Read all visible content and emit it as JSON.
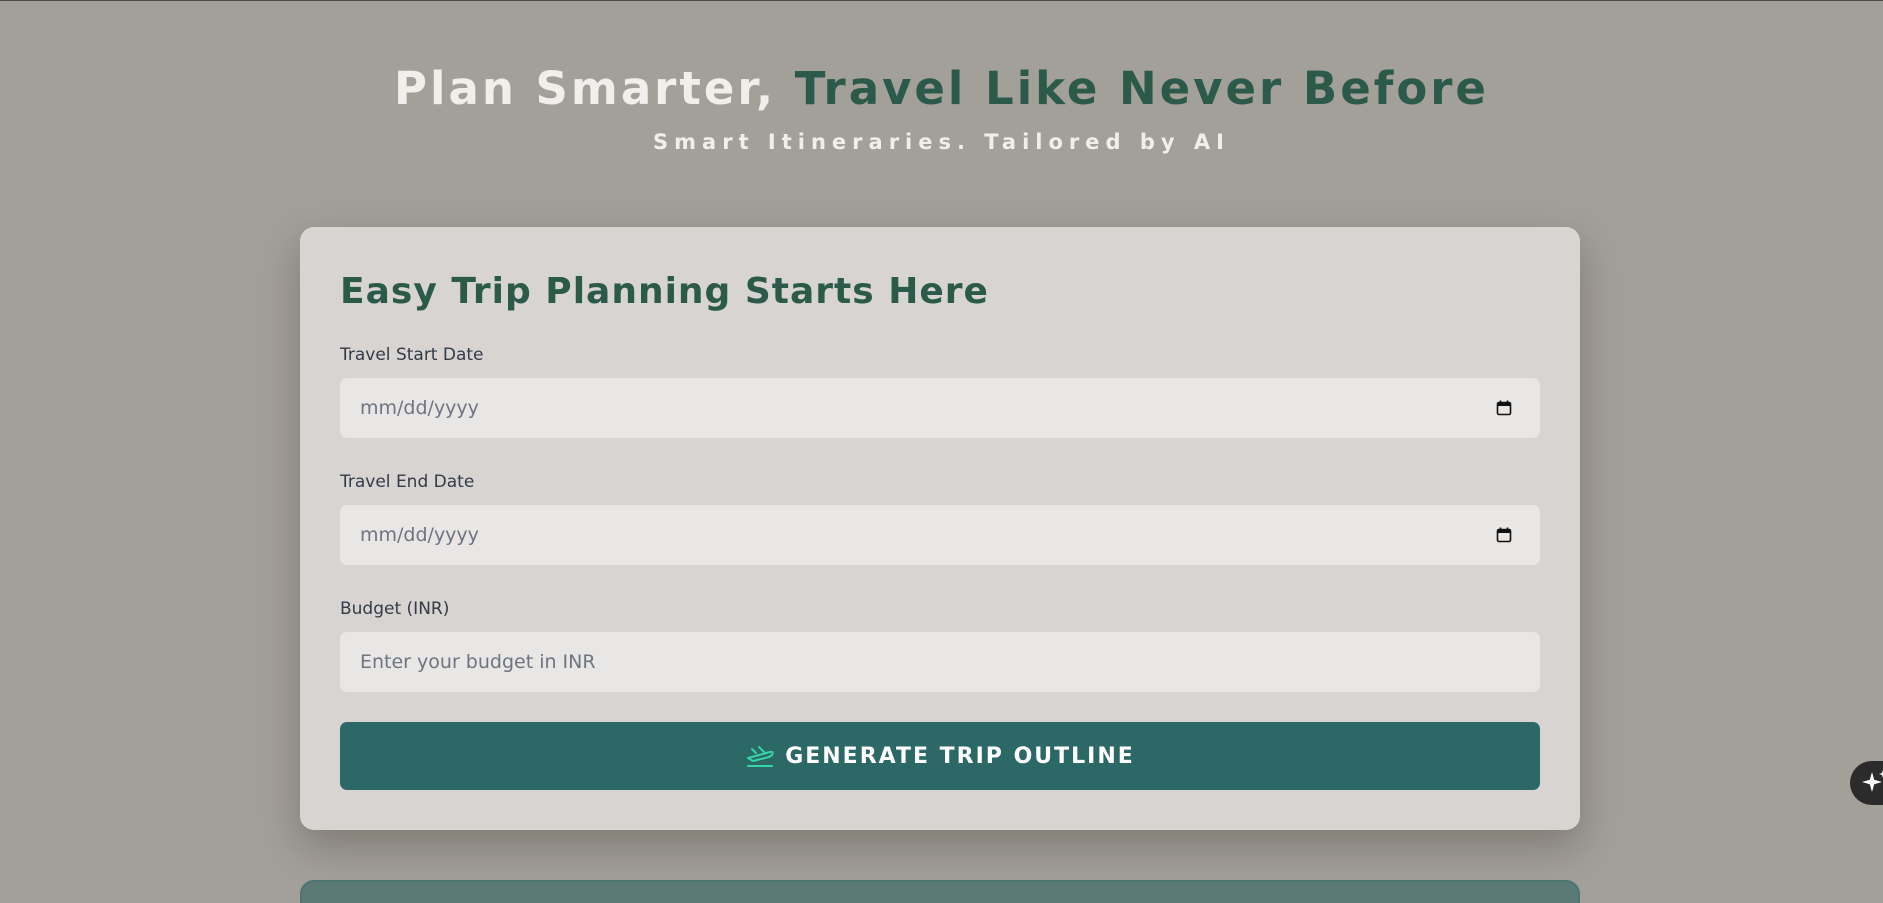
{
  "hero": {
    "title_plain": "Plan Smarter,",
    "title_accent": "Travel Like Never Before",
    "subtitle": "Smart Itineraries. Tailored by AI"
  },
  "form": {
    "title": "Easy Trip Planning Starts Here",
    "start_date": {
      "label": "Travel Start Date",
      "placeholder": "mm/dd/yyyy",
      "value": ""
    },
    "end_date": {
      "label": "Travel End Date",
      "placeholder": "mm/dd/yyyy",
      "value": ""
    },
    "budget": {
      "label": "Budget (INR)",
      "placeholder": "Enter your budget in INR",
      "value": ""
    },
    "submit_label": "GENERATE TRIP OUTLINE"
  },
  "icons": {
    "calendar": "calendar-icon",
    "plane": "plane-takeoff-icon",
    "sparkles": "sparkles-icon"
  },
  "colors": {
    "page_background": "#a39f99",
    "card_background": "#d8d4d1",
    "accent_green": "#2b5a4b",
    "button_teal": "#2b6866",
    "button_icon": "#37d6a6",
    "input_background": "#e8e7e5"
  }
}
